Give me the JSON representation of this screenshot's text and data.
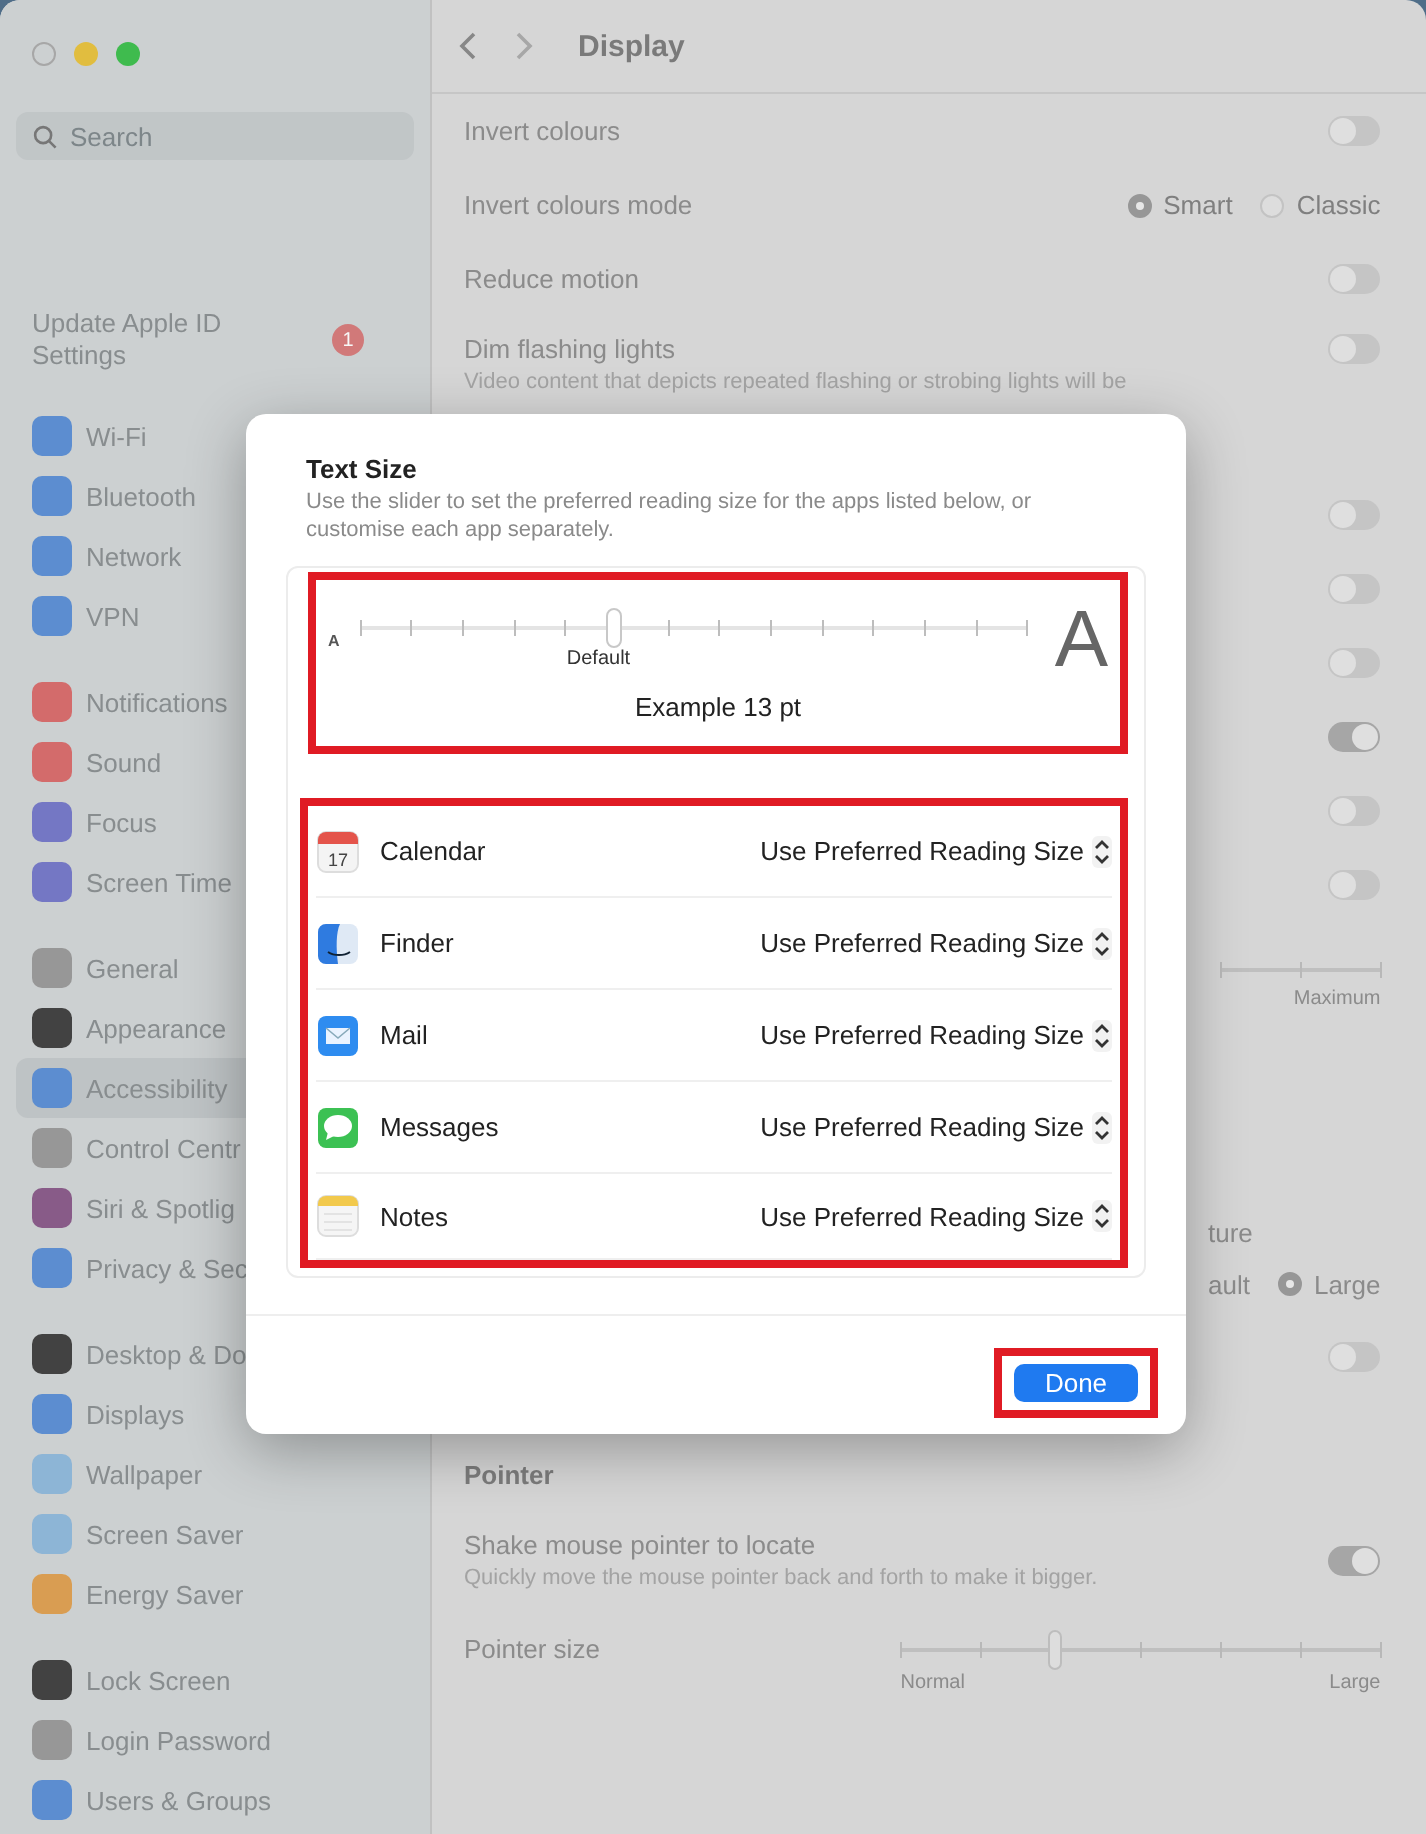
{
  "sidebar": {
    "search": {
      "placeholder": "Search"
    },
    "account": {
      "label": "Update Apple ID Settings",
      "badge": "1"
    },
    "groups": [
      [
        {
          "label": "Wi-Fi",
          "color": "#5b8fd6",
          "selected": false
        },
        {
          "label": "Bluetooth",
          "color": "#5b8fd6",
          "selected": false
        },
        {
          "label": "Network",
          "color": "#5b8fd6",
          "selected": false
        },
        {
          "label": "VPN",
          "color": "#5b8fd6",
          "selected": false
        }
      ],
      [
        {
          "label": "Notifications",
          "color": "#d96b6b",
          "selected": false
        },
        {
          "label": "Sound",
          "color": "#d96b6b",
          "selected": false
        },
        {
          "label": "Focus",
          "color": "#7478c9",
          "selected": false
        },
        {
          "label": "Screen Time",
          "color": "#7478c9",
          "selected": false
        }
      ],
      [
        {
          "label": "General",
          "color": "#9a9a9a",
          "selected": false
        },
        {
          "label": "Appearance",
          "color": "#3f3f3f",
          "selected": false
        },
        {
          "label": "Accessibility",
          "color": "#5b8fd6",
          "selected": true
        },
        {
          "label": "Control Centr",
          "color": "#9a9a9a",
          "selected": false
        },
        {
          "label": "Siri & Spotlig",
          "color": "#8a5a8a",
          "selected": false
        },
        {
          "label": "Privacy & Sec",
          "color": "#5b8fd6",
          "selected": false
        }
      ],
      [
        {
          "label": "Desktop & Do",
          "color": "#3f3f3f",
          "selected": false
        },
        {
          "label": "Displays",
          "color": "#5b8fd6",
          "selected": false
        },
        {
          "label": "Wallpaper",
          "color": "#8fb9dc",
          "selected": false
        },
        {
          "label": "Screen Saver",
          "color": "#8fb9dc",
          "selected": false
        },
        {
          "label": "Energy Saver",
          "color": "#e0a050",
          "selected": false
        }
      ],
      [
        {
          "label": "Lock Screen",
          "color": "#3f3f3f",
          "selected": false
        },
        {
          "label": "Login Password",
          "color": "#9a9a9a",
          "selected": false
        },
        {
          "label": "Users & Groups",
          "color": "#5b8fd6",
          "selected": false
        }
      ]
    ]
  },
  "pane": {
    "title": "Display",
    "rows": [
      {
        "kind": "toggle",
        "label": "Invert colours",
        "on": false
      },
      {
        "kind": "radio",
        "label": "Invert colours mode",
        "options": [
          {
            "label": "Smart",
            "selected": true
          },
          {
            "label": "Classic",
            "selected": false
          }
        ]
      },
      {
        "kind": "toggle",
        "label": "Reduce motion",
        "on": false
      },
      {
        "kind": "toggle",
        "label": "Dim flashing lights",
        "description": "Video content that depicts repeated flashing or strobing lights will be",
        "on": false
      },
      {
        "kind": "switch",
        "on": false
      },
      {
        "kind": "switch",
        "on": false
      },
      {
        "kind": "switch",
        "on": false
      },
      {
        "kind": "switch",
        "on": true
      },
      {
        "kind": "switch",
        "on": false
      },
      {
        "kind": "switch",
        "on": false
      },
      {
        "kind": "scale_end",
        "label": "Maximum"
      },
      {
        "kind": "fragment",
        "label": "ture"
      },
      {
        "kind": "fragment_radio",
        "label": "ault",
        "options": [
          {
            "label": "Large",
            "selected": true
          }
        ]
      },
      {
        "kind": "switch",
        "on": false
      },
      {
        "kind": "header",
        "label": "Pointer"
      },
      {
        "kind": "toggle",
        "label": "Shake mouse pointer to locate",
        "description": "Quickly move the mouse pointer back and forth to make it bigger.",
        "on": true
      },
      {
        "kind": "slider",
        "label": "Pointer size",
        "level": 0.32,
        "min_label": "Normal",
        "max_label": "Large"
      }
    ]
  },
  "dialog": {
    "title": "Text Size",
    "description": "Use the slider to set the preferred reading size for the apps listed below, or customise each app separately.",
    "slider": {
      "small_label": "A",
      "large_label": "A",
      "level": 0.38,
      "default_label": "Default",
      "example": "Example 13 pt",
      "highlighted": true
    },
    "apps": {
      "highlighted": true,
      "items": [
        {
          "name": "Calendar",
          "kind": "calendar",
          "icon_text": "17",
          "value": "Use Preferred Reading Size"
        },
        {
          "name": "Finder",
          "kind": "finder",
          "value": "Use Preferred Reading Size"
        },
        {
          "name": "Mail",
          "kind": "mail",
          "value": "Use Preferred Reading Size"
        },
        {
          "name": "Messages",
          "kind": "messages",
          "value": "Use Preferred Reading Size"
        },
        {
          "name": "Notes",
          "kind": "notes",
          "value": "Use Preferred Reading Size"
        }
      ]
    },
    "done": {
      "label": "Done",
      "highlighted": true
    }
  }
}
